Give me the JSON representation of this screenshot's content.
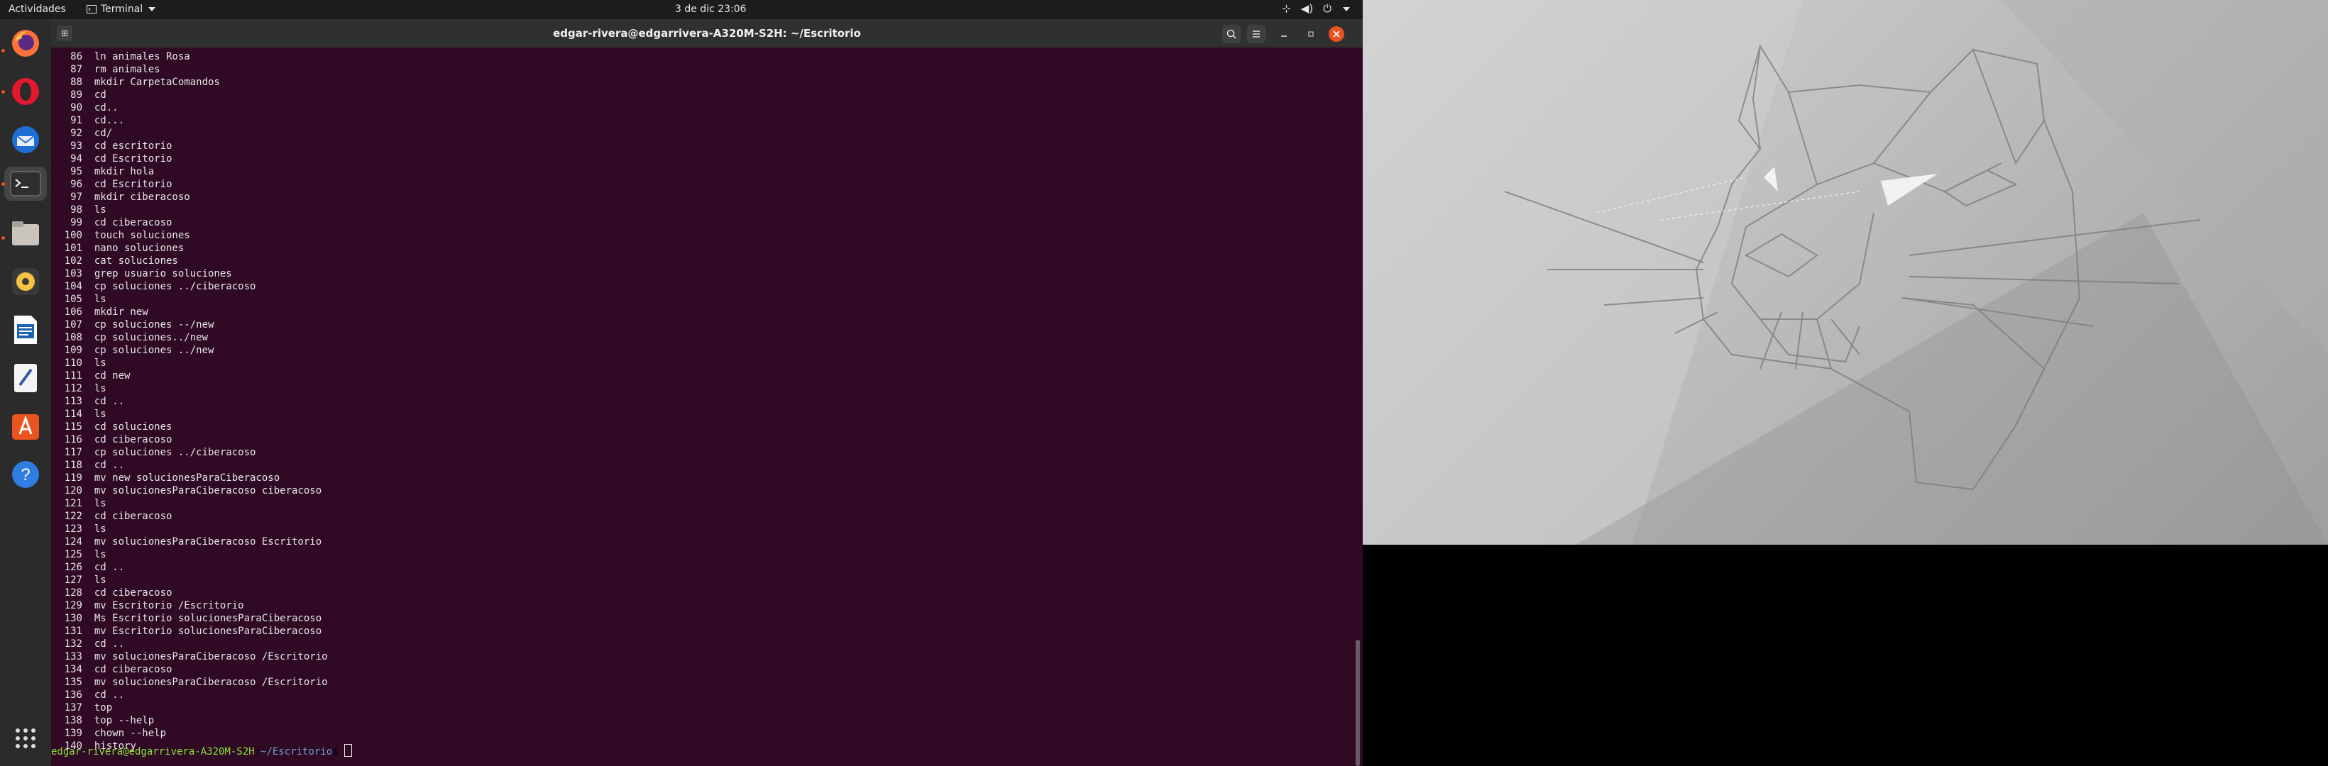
{
  "topbar": {
    "activities": "Actividades",
    "app_name": "Terminal",
    "clock": "3 de dic  23:06"
  },
  "dock": {
    "items": [
      "firefox-icon",
      "opera-icon",
      "thunderbird-icon",
      "terminal-icon",
      "files-icon",
      "rhythmbox-icon",
      "writer-icon",
      "text-editor-icon",
      "software-icon",
      "help-icon",
      "apps-grid-icon"
    ]
  },
  "terminal": {
    "title": "edgar-rivera@edgarrivera-A320M-S2H: ~/Escritorio",
    "history": [
      {
        "n": "86",
        "cmd": "ln animales Rosa"
      },
      {
        "n": "87",
        "cmd": "rm animales"
      },
      {
        "n": "88",
        "cmd": "mkdir CarpetaComandos"
      },
      {
        "n": "89",
        "cmd": "cd"
      },
      {
        "n": "90",
        "cmd": "cd.."
      },
      {
        "n": "91",
        "cmd": "cd..."
      },
      {
        "n": "92",
        "cmd": "cd/"
      },
      {
        "n": "93",
        "cmd": "cd escritorio"
      },
      {
        "n": "94",
        "cmd": "cd Escritorio"
      },
      {
        "n": "95",
        "cmd": "mkdir hola"
      },
      {
        "n": "96",
        "cmd": "cd Escritorio"
      },
      {
        "n": "97",
        "cmd": "mkdir ciberacoso"
      },
      {
        "n": "98",
        "cmd": "ls"
      },
      {
        "n": "99",
        "cmd": "cd ciberacoso"
      },
      {
        "n": "100",
        "cmd": "touch soluciones"
      },
      {
        "n": "101",
        "cmd": "nano soluciones"
      },
      {
        "n": "102",
        "cmd": "cat soluciones"
      },
      {
        "n": "103",
        "cmd": "grep usuario soluciones"
      },
      {
        "n": "104",
        "cmd": "cp soluciones ../ciberacoso"
      },
      {
        "n": "105",
        "cmd": "ls"
      },
      {
        "n": "106",
        "cmd": "mkdir new"
      },
      {
        "n": "107",
        "cmd": "cp soluciones --/new"
      },
      {
        "n": "108",
        "cmd": "cp soluciones../new"
      },
      {
        "n": "109",
        "cmd": "cp soluciones ../new"
      },
      {
        "n": "110",
        "cmd": "ls"
      },
      {
        "n": "111",
        "cmd": "cd new"
      },
      {
        "n": "112",
        "cmd": "ls"
      },
      {
        "n": "113",
        "cmd": "cd .."
      },
      {
        "n": "114",
        "cmd": "ls"
      },
      {
        "n": "115",
        "cmd": "cd soluciones"
      },
      {
        "n": "116",
        "cmd": "cd ciberacoso"
      },
      {
        "n": "117",
        "cmd": "cp soluciones ../ciberacoso"
      },
      {
        "n": "118",
        "cmd": "cd .."
      },
      {
        "n": "119",
        "cmd": "mv new solucionesParaCiberacoso"
      },
      {
        "n": "120",
        "cmd": "mv solucionesParaCiberacoso ciberacoso"
      },
      {
        "n": "121",
        "cmd": "ls"
      },
      {
        "n": "122",
        "cmd": "cd ciberacoso"
      },
      {
        "n": "123",
        "cmd": "ls"
      },
      {
        "n": "124",
        "cmd": "mv solucionesParaCiberacoso Escritorio"
      },
      {
        "n": "125",
        "cmd": "ls"
      },
      {
        "n": "126",
        "cmd": "cd .."
      },
      {
        "n": "127",
        "cmd": "ls"
      },
      {
        "n": "128",
        "cmd": "cd ciberacoso"
      },
      {
        "n": "129",
        "cmd": "mv Escritorio /Escritorio"
      },
      {
        "n": "130",
        "cmd": "Ms Escritorio solucionesParaCiberacoso"
      },
      {
        "n": "131",
        "cmd": "mv Escritorio solucionesParaCiberacoso"
      },
      {
        "n": "132",
        "cmd": "cd .."
      },
      {
        "n": "133",
        "cmd": "mv solucionesParaCiberacoso /Escritorio"
      },
      {
        "n": "134",
        "cmd": "cd ciberacoso"
      },
      {
        "n": "135",
        "cmd": "mv solucionesParaCiberacoso /Escritorio"
      },
      {
        "n": "136",
        "cmd": "cd .."
      },
      {
        "n": "137",
        "cmd": "top"
      },
      {
        "n": "138",
        "cmd": "top --help"
      },
      {
        "n": "139",
        "cmd": "chown --help"
      },
      {
        "n": "140",
        "cmd": "history"
      }
    ],
    "prompt_user": "edgar-rivera@edgarrivera-A320M-S2H",
    "prompt_sep": ":",
    "prompt_path": "~/Escritorio",
    "prompt_end": "$ "
  },
  "colors": {
    "terminal_bg": "#300a24",
    "accent": "#e95420",
    "prompt_user": "#8ae234",
    "prompt_path": "#729fcf"
  }
}
